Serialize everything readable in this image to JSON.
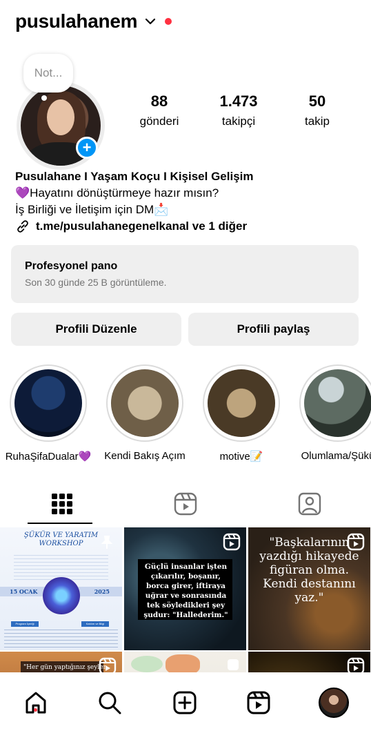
{
  "header": {
    "username": "pusulahanem"
  },
  "note": {
    "placeholder": "Not..."
  },
  "stats": [
    {
      "value": "88",
      "label": "gönderi"
    },
    {
      "value": "1.473",
      "label": "takipçi"
    },
    {
      "value": "50",
      "label": "takip"
    }
  ],
  "bio": {
    "name": "Pusulahane I Yaşam Koçu I Kişisel Gelişim",
    "line1": "💜Hayatını dönüştürmeye hazır mısın?",
    "line2": "İş Birliği ve İletişim için DM📩",
    "link": "t.me/pusulahanegenelkanal ve 1 diğer"
  },
  "dashboard": {
    "title": "Profesyonel pano",
    "subtitle": "Son 30 günde 25 B görüntüleme."
  },
  "buttons": {
    "edit": "Profili Düzenle",
    "share": "Profili paylaş"
  },
  "highlights": [
    {
      "label": "RuhaŞifaDualar💜"
    },
    {
      "label": "Kendi Bakış Açım"
    },
    {
      "label": "motive📝"
    },
    {
      "label": "Olumlama/Şükü"
    }
  ],
  "posts": {
    "p1": {
      "title": "ŞÜKÜR VE YARATIM WORKSHOP",
      "date": "15 OCAK",
      "year": "2025",
      "btn1": "Program İçeriği",
      "btn2": "Katılım ve Bilgi"
    },
    "p2": {
      "text": "Güçlü insanlar işten çıkarılır, boşanır, borca girer, iftiraya uğrar ve sonrasında tek söyledikleri şey şudur: \"Hallederim.\""
    },
    "p3": {
      "text": "\"Başkalarının yazdığı hikayede figüran olma. Kendi destanını yaz.\""
    },
    "p4": {
      "text": "\"Her gün yaptığınız şeyler"
    }
  },
  "icons": {
    "chevron": "chevron-down-icon",
    "grid": "grid-icon",
    "reels": "reels-icon",
    "tagged": "tagged-icon",
    "home": "home-icon",
    "search": "search-icon",
    "create": "create-icon",
    "reels_nav": "reels-nav-icon"
  },
  "colors": {
    "accent": "#0095f6",
    "notification": "#ff3040"
  }
}
